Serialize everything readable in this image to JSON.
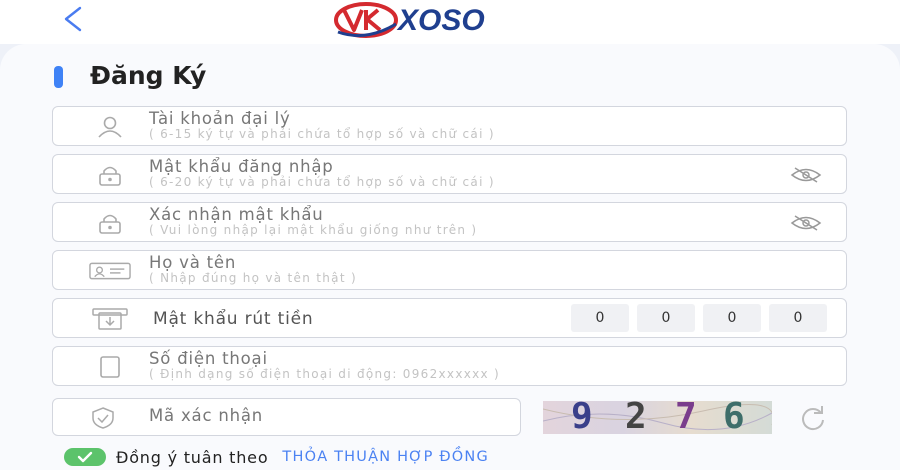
{
  "header": {
    "logo_text": "XOSO"
  },
  "page": {
    "title": "Đăng Ký"
  },
  "form": {
    "username": {
      "label": "Tài khoản đại lý",
      "hint": "( 6-15 ký tự và phải chứa tổ hợp số và chữ cái )"
    },
    "password": {
      "label": "Mật khẩu đăng nhập",
      "hint": "( 6-20 ký tự và phải chứa tổ hợp số và chữ cái )"
    },
    "confirm_password": {
      "label": "Xác nhận mật khẩu",
      "hint": "( Vui lòng nhập lại mật khẩu giống như trên )"
    },
    "full_name": {
      "label": "Họ và tên",
      "hint": "( Nhập đúng họ và tên thật )"
    },
    "withdraw_pin": {
      "label": "Mật khẩu rút tiền",
      "digits": [
        "0",
        "0",
        "0",
        "0"
      ]
    },
    "phone": {
      "label": "Số điện thoại",
      "hint": "( Định dạng số điện thoại di động: 0962xxxxxx )"
    },
    "captcha": {
      "label": "Mã xác nhận",
      "code_chars": [
        "9",
        "2",
        "7",
        "6"
      ]
    },
    "agreement": {
      "text": "Đồng ý tuân theo",
      "link": "THỎA THUẬN HỢP ĐỒNG"
    }
  },
  "colors": {
    "accent": "#3f82f6",
    "link": "#4b82f2",
    "check": "#5cc36b",
    "logo_red": "#d42a2f",
    "logo_blue": "#1f3f8f"
  },
  "icons": [
    "chevron-left-icon",
    "user-icon",
    "lock-icon",
    "id-card-icon",
    "withdraw-icon",
    "phone-icon",
    "shield-check-icon",
    "eye-off-icon",
    "refresh-icon",
    "check-icon"
  ]
}
